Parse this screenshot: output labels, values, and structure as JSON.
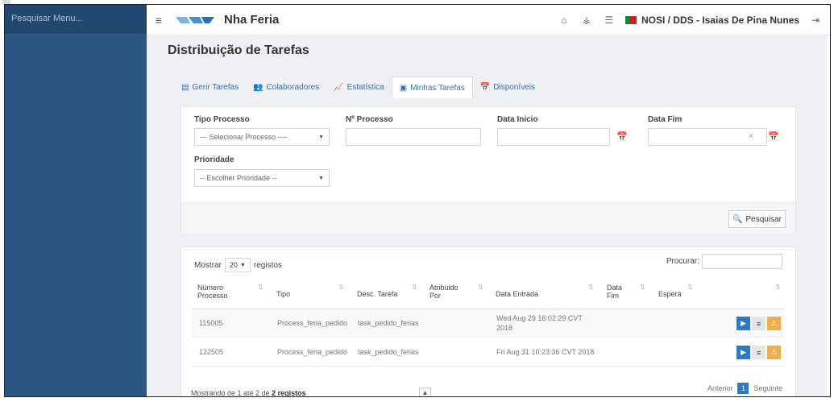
{
  "sidebar": {
    "search_placeholder": "Pesquisar Menu..."
  },
  "header": {
    "app_title": "Nha Feria",
    "user": "NOSI / DDS - Isaias De Pina Nunes",
    "icons": [
      "menu-icon",
      "home-icon",
      "sitemap-icon",
      "list-icon",
      "flag-icon",
      "logout-icon"
    ]
  },
  "page": {
    "title": "Distribuição de Tarefas"
  },
  "tabs": [
    {
      "label": "Gerir Tarefas",
      "icon": "list-icon"
    },
    {
      "label": "Colaboradores",
      "icon": "users-icon"
    },
    {
      "label": "Estatística",
      "icon": "chart-icon"
    },
    {
      "label": "Minhas Tarefas",
      "icon": "task-icon",
      "active": true
    },
    {
      "label": "Disponíveis",
      "icon": "calendar-icon"
    }
  ],
  "filters": {
    "tipo_processo_label": "Tipo Processo",
    "tipo_processo_value": "--- Selecionar Processo ----",
    "num_processo_label": "Nº Processo",
    "num_processo_value": "",
    "data_inicio_label": "Data Inicio",
    "data_inicio_value": "",
    "data_fim_label": "Data Fim",
    "data_fim_value": "",
    "prioridade_label": "Prioridade",
    "prioridade_value": "-- Escolher Prioridade --",
    "search_button": "Pesquisar"
  },
  "table": {
    "show_label": "Mostrar",
    "page_length": "20",
    "records_label": "registos",
    "search_label": "Procurar:",
    "columns": {
      "numero_processo": "Número Processo",
      "tipo": "Tipo",
      "desc_tarefa": "Desc. Tarefa",
      "atribuido_por": "Atribuido Por",
      "data_entrada": "Data Entrada",
      "data_fim": "Data Fim",
      "espera": "Espera"
    },
    "rows": [
      {
        "numero": "115005",
        "tipo": "Process_feria_pedido",
        "desc": "task_pedido_ferias",
        "atribuido": "",
        "data_entrada": "Wed Aug 29 16:02:29 CVT 2018",
        "data_fim": "",
        "espera": ""
      },
      {
        "numero": "122505",
        "tipo": "Process_feria_pedido",
        "desc": "task_pedido_ferias",
        "atribuido": "",
        "data_entrada": "Fri Aug 31 10:23:36 CVT 2018",
        "data_fim": "",
        "espera": ""
      }
    ],
    "info_prefix": "Mostrando de 1 até 2 de",
    "info_total": "2 registos",
    "pager": {
      "prev": "Anterior",
      "current": "1",
      "next": "Seguinte"
    }
  }
}
